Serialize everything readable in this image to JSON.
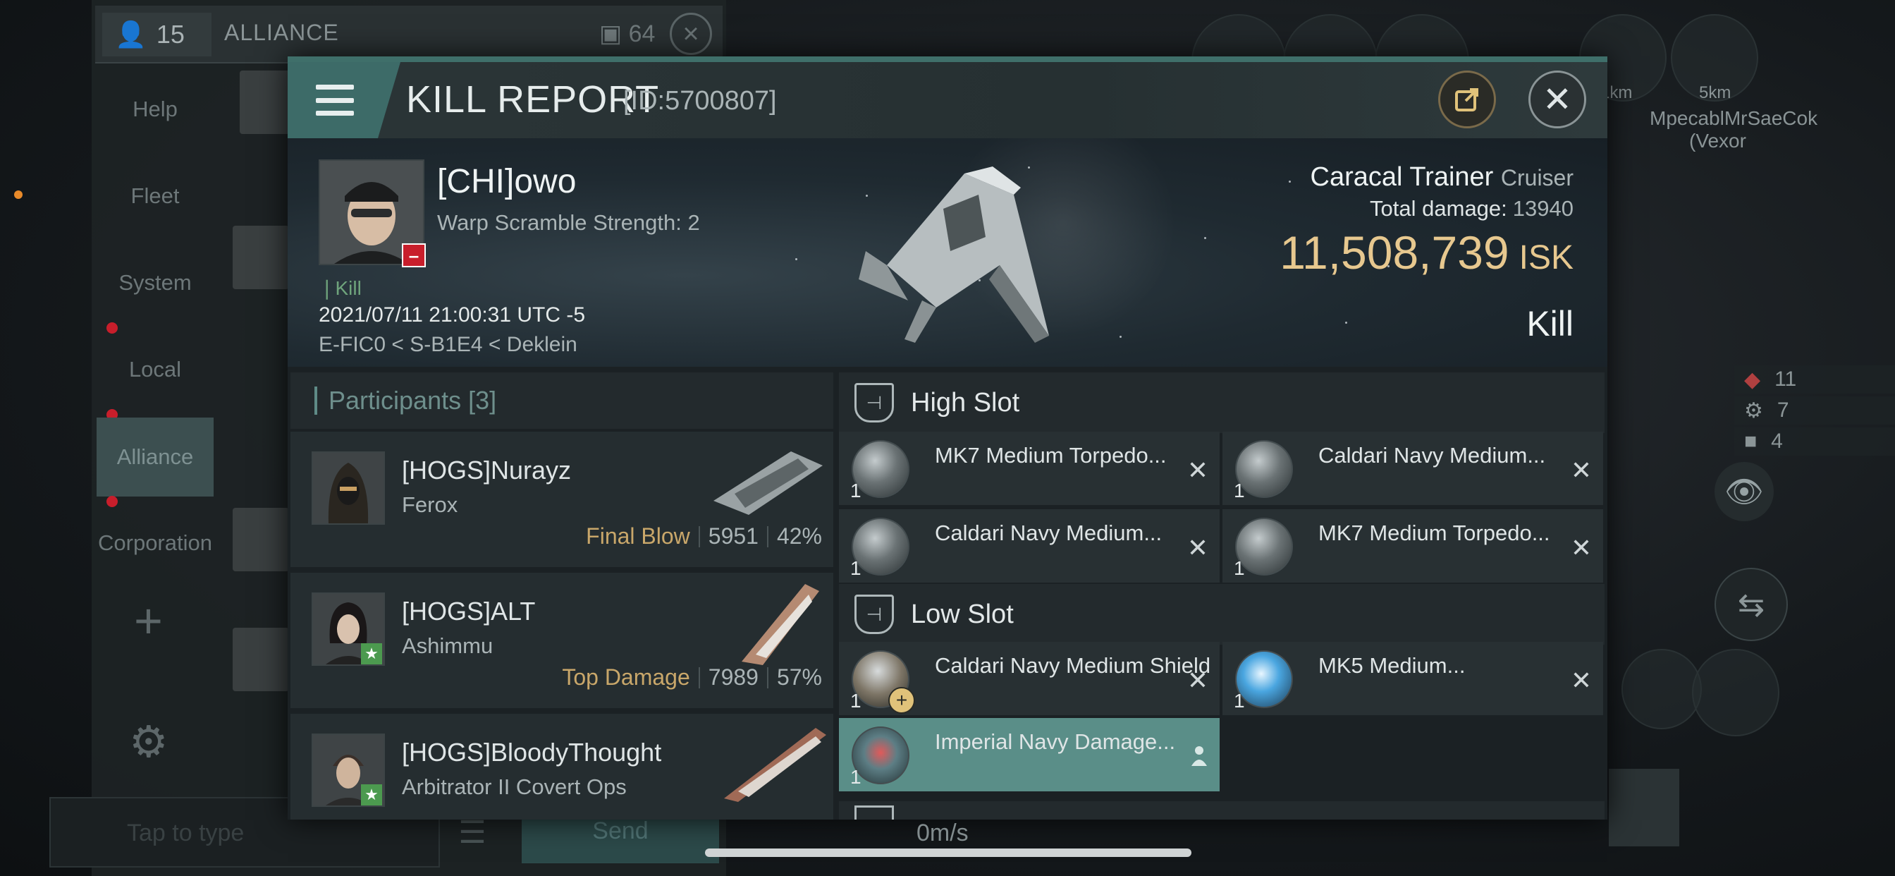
{
  "chat": {
    "member_count": "15",
    "channel": "ALLIANCE",
    "unread": "64",
    "nav": [
      {
        "label": "Help"
      },
      {
        "label": "Fleet"
      },
      {
        "label": "System"
      },
      {
        "label": "Local"
      },
      {
        "label": "Alliance"
      },
      {
        "label": "Corporation"
      }
    ],
    "send_label": "Send",
    "input_placeholder": "Tap to type"
  },
  "hud": {
    "distances": [
      "1km",
      "5km"
    ],
    "pilots": [
      "MpecablMrSaeCok",
      "(Vexor"
    ],
    "stats": [
      "11",
      "7",
      "4"
    ],
    "speed": "0m/s"
  },
  "report": {
    "title": "KILL REPORT",
    "id": "[ID:5700807]",
    "victim": {
      "name": "[CHI]owo",
      "scram": "Warp Scramble Strength: 2",
      "tag": "Kill",
      "time": "2021/07/11 21:00:31 UTC -5",
      "location": "E-FIC0 < S-B1E4 < Deklein"
    },
    "ship": {
      "name": "Caracal Trainer",
      "class": "Cruiser",
      "damage_label": "Total damage:",
      "damage": "13940",
      "isk_value": "11,508,739",
      "isk_unit": "ISK",
      "result": "Kill"
    },
    "participants_label": "Participants",
    "participants_count": "[3]",
    "participants": [
      {
        "name": "[HOGS]Nurayz",
        "ship": "Ferox",
        "role": "Final Blow",
        "damage": "5951",
        "percent": "42%"
      },
      {
        "name": "[HOGS]ALT",
        "ship": "Ashimmu",
        "role": "Top Damage",
        "damage": "7989",
        "percent": "57%"
      },
      {
        "name": "[HOGS]BloodyThought",
        "ship": "Arbitrator II Covert Ops",
        "role": "",
        "damage": "",
        "percent": ""
      }
    ],
    "high_slot_label": "High Slot",
    "low_slot_label": "Low Slot",
    "high_slot": [
      {
        "qty": "1",
        "name": "MK7 Medium Torpedo..."
      },
      {
        "qty": "1",
        "name": "Caldari Navy Medium..."
      },
      {
        "qty": "1",
        "name": "Caldari Navy Medium..."
      },
      {
        "qty": "1",
        "name": "MK7 Medium Torpedo..."
      }
    ],
    "low_slot": [
      {
        "qty": "1",
        "name": "Caldari Navy Medium Shield ..."
      },
      {
        "qty": "1",
        "name": "MK5 Medium..."
      },
      {
        "qty": "1",
        "name": "Imperial Navy Damage..."
      }
    ]
  },
  "colors": {
    "accent": "#3d6b68",
    "isk": "#e7c88f",
    "role": "#c9a76a",
    "highlight": "#5a8e88"
  }
}
